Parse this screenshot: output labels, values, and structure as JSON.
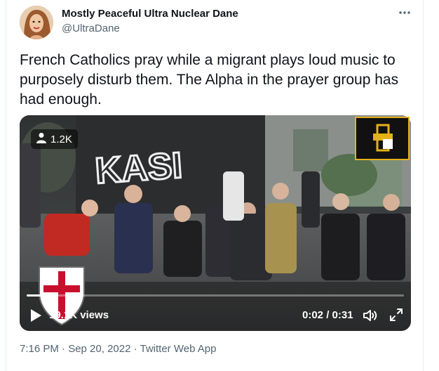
{
  "author": {
    "name": "Mostly Peaceful Ultra Nuclear Dane",
    "handle": "@UltraDane"
  },
  "tweet": {
    "text": "French Catholics pray while a migrant plays loud music to purposely disturb them. The Alpha in the prayer group has had enough."
  },
  "video": {
    "badge_views": "1.2K",
    "view_count": "19.1K views",
    "time": "0:02 / 0:31",
    "wall_graffiti": "KASI",
    "progress": 0.065
  },
  "meta": {
    "timestamp": "7:16 PM · Sep 20, 2022 · Twitter Web App"
  },
  "icons": {
    "more": "more-options-icon",
    "person": "person-icon",
    "play": "play-icon",
    "volume": "volume-icon",
    "fullscreen": "fullscreen-icon"
  }
}
